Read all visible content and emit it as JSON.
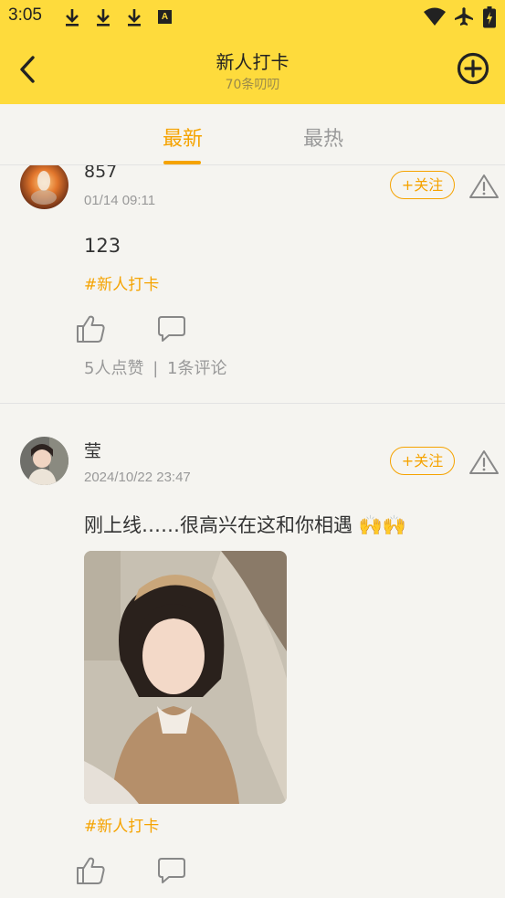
{
  "status_bar": {
    "time": "3:05",
    "keyboard_indicator": "A"
  },
  "header": {
    "title": "新人打卡",
    "subtitle": "70条叨叨"
  },
  "tabs": [
    {
      "label": "最新"
    },
    {
      "label": "最热"
    }
  ],
  "posts": [
    {
      "username": "857",
      "time": "01/14 09:11",
      "follow_label": "+关注",
      "content": "123",
      "tag": "#新人打卡",
      "likes_text": "5人点赞",
      "separator": "|",
      "comments_text": "1条评论"
    },
    {
      "username": "莹",
      "time": "2024/10/22 23:47",
      "follow_label": "+关注",
      "content": "刚上线……很高兴在这和你相遇 🙌🙌",
      "tag": "#新人打卡"
    }
  ],
  "colors": {
    "brand_yellow": "#fedb3c",
    "accent_orange": "#f5a300",
    "muted_text": "#999999"
  },
  "icons": [
    "download-icon",
    "keyboard-icon",
    "wifi-icon",
    "airplane-icon",
    "battery-icon",
    "back-arrow-icon",
    "add-circle-icon",
    "warning-icon",
    "thumbs-up-icon",
    "comment-icon"
  ]
}
